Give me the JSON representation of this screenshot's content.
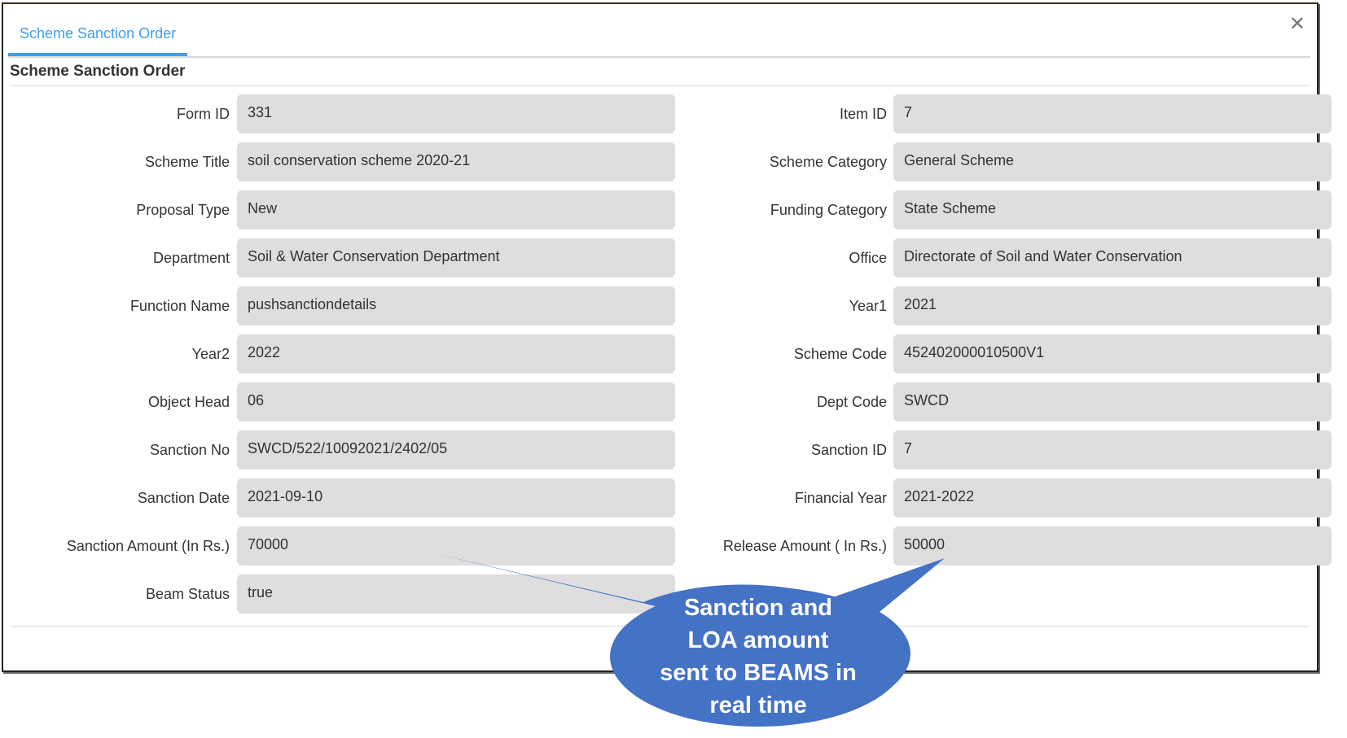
{
  "tab": {
    "label": "Scheme Sanction Order"
  },
  "close_icon": "close-icon",
  "section": {
    "title": "Scheme Sanction Order"
  },
  "left_fields": [
    {
      "label": "Form ID",
      "value": "331"
    },
    {
      "label": "Scheme Title",
      "value": "soil conservation scheme 2020-21"
    },
    {
      "label": "Proposal Type",
      "value": "New"
    },
    {
      "label": "Department",
      "value": "Soil & Water Conservation Department"
    },
    {
      "label": "Function Name",
      "value": "pushsanctiondetails"
    },
    {
      "label": "Year2",
      "value": "2022"
    },
    {
      "label": "Object Head",
      "value": "06"
    },
    {
      "label": "Sanction No",
      "value": "SWCD/522/10092021/2402/05"
    },
    {
      "label": "Sanction Date",
      "value": "2021-09-10"
    },
    {
      "label": "Sanction Amount (In Rs.)",
      "value": "70000"
    },
    {
      "label": "Beam Status",
      "value": "true"
    }
  ],
  "right_fields": [
    {
      "label": "Item ID",
      "value": "7"
    },
    {
      "label": "Scheme Category",
      "value": "General Scheme"
    },
    {
      "label": "Funding Category",
      "value": "State Scheme"
    },
    {
      "label": "Office",
      "value": "Directorate of Soil and Water Conservation"
    },
    {
      "label": "Year1",
      "value": "2021"
    },
    {
      "label": "Scheme Code",
      "value": "452402000010500V1"
    },
    {
      "label": "Dept Code",
      "value": "SWCD"
    },
    {
      "label": "Sanction ID",
      "value": "7"
    },
    {
      "label": "Financial Year",
      "value": "2021-2022"
    },
    {
      "label": "Release Amount ( In Rs.)",
      "value": "50000"
    }
  ],
  "callout": {
    "lines": [
      "Sanction and",
      "LOA amount",
      "sent to BEAMS in",
      "real time"
    ],
    "color": "#4472c4"
  },
  "colors": {
    "accent": "#3f9fe6",
    "field_bg": "#dedede"
  }
}
